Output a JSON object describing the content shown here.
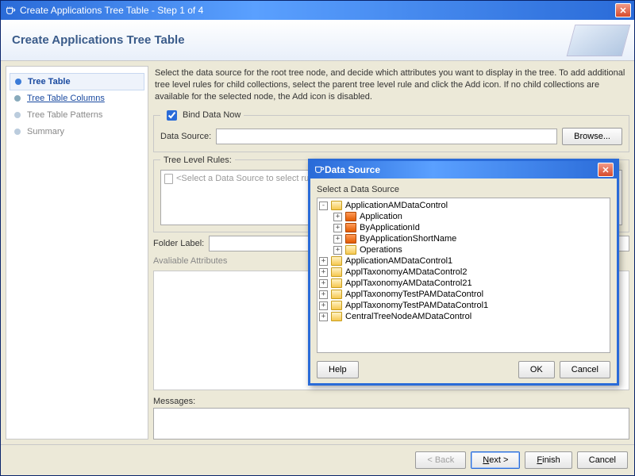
{
  "window": {
    "title": "Create Applications Tree Table - Step 1 of 4",
    "banner_title": "Create Applications Tree Table"
  },
  "steps": [
    {
      "label": "Tree Table"
    },
    {
      "label": "Tree Table Columns"
    },
    {
      "label": "Tree Table Patterns"
    },
    {
      "label": "Summary"
    }
  ],
  "instructions": "Select the data source for the root tree node, and decide which attributes you want to display in the tree. To add additional tree level rules for child collections, select the parent tree level rule and click the Add icon. If no child collections are available for the selected node, the Add icon is disabled.",
  "bind_group": {
    "legend": "Bind Data Now",
    "checkbox_checked": true,
    "data_source_label": "Data Source:",
    "data_source_value": "",
    "browse_label": "Browse..."
  },
  "rules_group": {
    "legend": "Tree Level Rules:",
    "placeholder": "<Select a Data Source to select rules>"
  },
  "folder_label_text": "Folder Label:",
  "folder_label_value": "",
  "avail_attr_label": "Avaliable Attributes",
  "messages_label": "Messages:",
  "footer": {
    "back": "< Back",
    "next": "Next >",
    "finish": "Finish",
    "cancel": "Cancel"
  },
  "modal": {
    "title": "Data Source",
    "subhead": "Select a Data Source",
    "tree": [
      {
        "level": 0,
        "exp": "-",
        "icon": "folder",
        "label": "ApplicationAMDataControl"
      },
      {
        "level": 1,
        "exp": "+",
        "icon": "table",
        "label": "Application"
      },
      {
        "level": 1,
        "exp": "+",
        "icon": "table",
        "label": "ByApplicationId"
      },
      {
        "level": 1,
        "exp": "+",
        "icon": "table",
        "label": "ByApplicationShortName"
      },
      {
        "level": 1,
        "exp": "+",
        "icon": "folder",
        "label": "Operations"
      },
      {
        "level": 0,
        "exp": "+",
        "icon": "folder",
        "label": "ApplicationAMDataControl1"
      },
      {
        "level": 0,
        "exp": "+",
        "icon": "folder",
        "label": "ApplTaxonomyAMDataControl2"
      },
      {
        "level": 0,
        "exp": "+",
        "icon": "folder",
        "label": "ApplTaxonomyAMDataControl21"
      },
      {
        "level": 0,
        "exp": "+",
        "icon": "folder",
        "label": "ApplTaxonomyTestPAMDataControl"
      },
      {
        "level": 0,
        "exp": "+",
        "icon": "folder",
        "label": "ApplTaxonomyTestPAMDataControl1"
      },
      {
        "level": 0,
        "exp": "+",
        "icon": "folder",
        "label": "CentralTreeNodeAMDataControl"
      }
    ],
    "help": "Help",
    "ok": "OK",
    "cancel": "Cancel"
  }
}
